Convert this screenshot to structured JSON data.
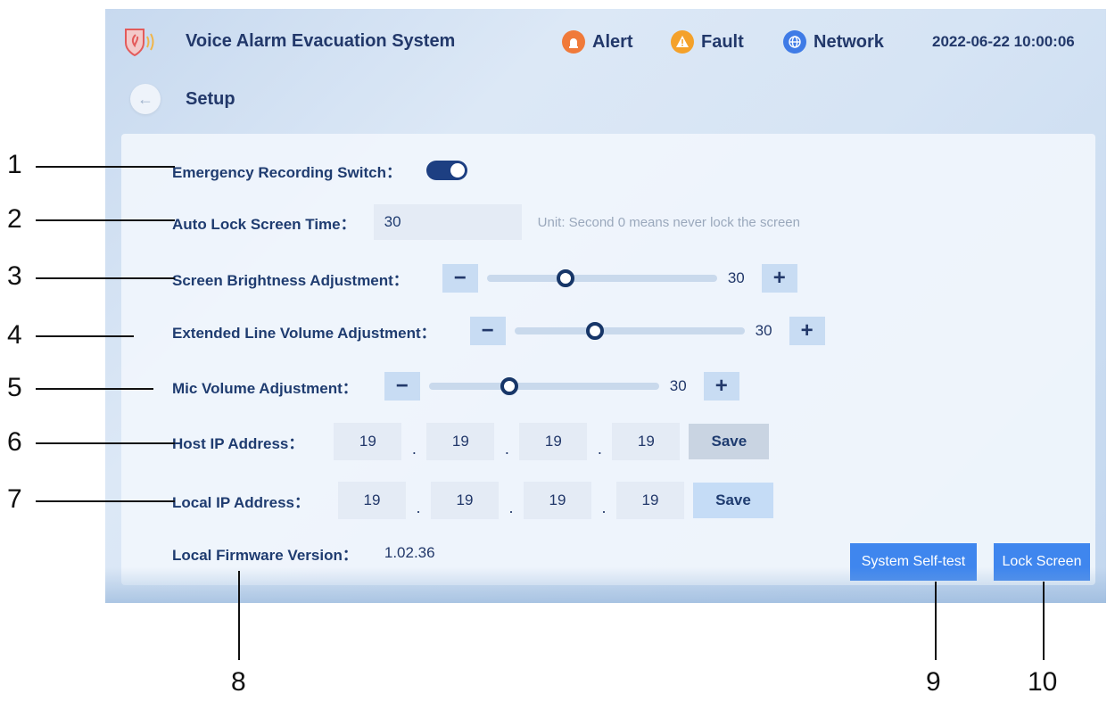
{
  "header": {
    "app_title": "Voice Alarm Evacuation System",
    "status": [
      {
        "label": "Alert",
        "icon": "alarm-icon"
      },
      {
        "label": "Fault",
        "icon": "warning-icon"
      },
      {
        "label": "Network",
        "icon": "globe-icon"
      }
    ],
    "datetime": "2022-06-22  10:00:06"
  },
  "page": {
    "title": "Setup"
  },
  "settings": {
    "emergency_recording": {
      "label": "Emergency Recording Switch：",
      "on": true
    },
    "auto_lock": {
      "label": "Auto Lock Screen Time：",
      "value": "30",
      "hint": "Unit: Second   0 means never lock the screen"
    },
    "brightness": {
      "label": "Screen Brightness Adjustment：",
      "value": "30",
      "minus": "−",
      "plus": "+",
      "level": 0.34
    },
    "ext_volume": {
      "label": "Extended Line Volume Adjustment：",
      "value": "30",
      "minus": "−",
      "plus": "+",
      "level": 0.35
    },
    "mic_volume": {
      "label": "Mic Volume Adjustment：",
      "value": "30",
      "minus": "−",
      "plus": "+",
      "level": 0.35
    },
    "host_ip": {
      "label": "Host IP Address：",
      "octets": [
        "19",
        "19",
        "19",
        "19"
      ],
      "save": "Save"
    },
    "local_ip": {
      "label": "Local IP Address：",
      "octets": [
        "19",
        "19",
        "19",
        "19"
      ],
      "save": "Save"
    },
    "firmware": {
      "label": "Local Firmware Version：",
      "value": "1.02.36"
    }
  },
  "actions": {
    "self_test": "System Self-test",
    "lock_screen": "Lock Screen"
  },
  "callouts": [
    "1",
    "2",
    "3",
    "4",
    "5",
    "6",
    "7",
    "8",
    "9",
    "10"
  ],
  "colors": {
    "accent": "#3f86ee",
    "toggle": "#1d3f82",
    "text": "#1f3c70"
  }
}
